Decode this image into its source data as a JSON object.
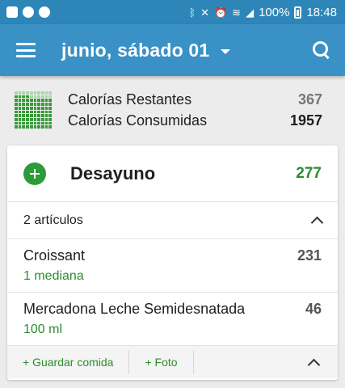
{
  "status_bar": {
    "battery_percent": "100%",
    "time": "18:48",
    "left_icons": [
      "youtube-icon",
      "messenger-icon",
      "spotify-icon"
    ],
    "right_icons": [
      "bluetooth-icon",
      "mute-icon",
      "alarm-icon",
      "wifi-icon",
      "signal-icon",
      "battery-icon"
    ]
  },
  "app_bar": {
    "title": "junio, sábado 01",
    "color": "#3a91c6"
  },
  "summary": {
    "remaining_label": "Calorías Restantes",
    "remaining_value": "367",
    "consumed_label": "Calorías Consumidas",
    "consumed_value": "1957",
    "consumed_fraction": 0.84
  },
  "meal": {
    "name": "Desayuno",
    "calories": "277",
    "items_count_label": "2 artículos",
    "items": [
      {
        "name": "Croissant",
        "portion": "1  mediana",
        "calories": "231"
      },
      {
        "name": "Mercadona Leche Semidesnatada",
        "portion": "100 ml",
        "calories": "46"
      }
    ],
    "save_meal_label": "+ Guardar comida",
    "photo_label": "+ Foto"
  },
  "colors": {
    "green": "#2e8b2e",
    "status_bar": "#2e86b8"
  }
}
